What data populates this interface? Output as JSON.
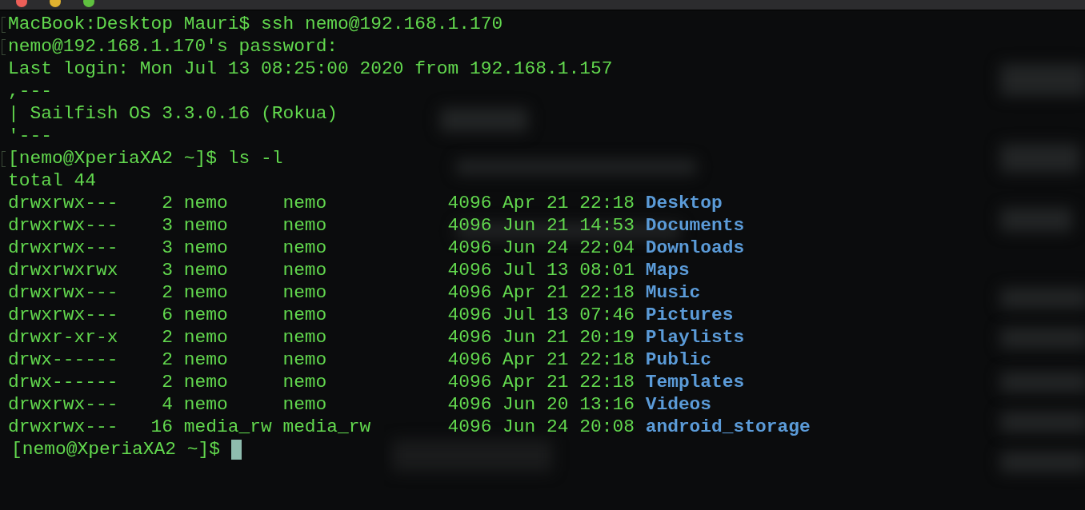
{
  "terminal": {
    "lines": [
      {
        "text": "MacBook:Desktop Mauri$ ssh nemo@192.168.1.170",
        "marked": true
      },
      {
        "text": "nemo@192.168.1.170's password:",
        "marked": true
      },
      {
        "text": "Last login: Mon Jul 13 08:25:00 2020 from 192.168.1.157",
        "marked": false
      },
      {
        "text": ",---",
        "marked": false
      },
      {
        "text": "| Sailfish OS 3.3.0.16 (Rokua)",
        "marked": false
      },
      {
        "text": "'---",
        "marked": false
      },
      {
        "text": "[nemo@XperiaXA2 ~]$ ls -l",
        "marked": true
      },
      {
        "text": "total 44",
        "marked": false
      }
    ],
    "listing": [
      {
        "mode": "drwxrwx---",
        "links": "2",
        "owner": "nemo",
        "group": "nemo",
        "size": "4096",
        "date": "Apr 21 22:18",
        "name": "Desktop"
      },
      {
        "mode": "drwxrwx---",
        "links": "3",
        "owner": "nemo",
        "group": "nemo",
        "size": "4096",
        "date": "Jun 21 14:53",
        "name": "Documents"
      },
      {
        "mode": "drwxrwx---",
        "links": "3",
        "owner": "nemo",
        "group": "nemo",
        "size": "4096",
        "date": "Jun 24 22:04",
        "name": "Downloads"
      },
      {
        "mode": "drwxrwxrwx",
        "links": "3",
        "owner": "nemo",
        "group": "nemo",
        "size": "4096",
        "date": "Jul 13 08:01",
        "name": "Maps"
      },
      {
        "mode": "drwxrwx---",
        "links": "2",
        "owner": "nemo",
        "group": "nemo",
        "size": "4096",
        "date": "Apr 21 22:18",
        "name": "Music"
      },
      {
        "mode": "drwxrwx---",
        "links": "6",
        "owner": "nemo",
        "group": "nemo",
        "size": "4096",
        "date": "Jul 13 07:46",
        "name": "Pictures"
      },
      {
        "mode": "drwxr-xr-x",
        "links": "2",
        "owner": "nemo",
        "group": "nemo",
        "size": "4096",
        "date": "Jun 21 20:19",
        "name": "Playlists"
      },
      {
        "mode": "drwx------",
        "links": "2",
        "owner": "nemo",
        "group": "nemo",
        "size": "4096",
        "date": "Apr 21 22:18",
        "name": "Public"
      },
      {
        "mode": "drwx------",
        "links": "2",
        "owner": "nemo",
        "group": "nemo",
        "size": "4096",
        "date": "Apr 21 22:18",
        "name": "Templates"
      },
      {
        "mode": "drwxrwx---",
        "links": "4",
        "owner": "nemo",
        "group": "nemo",
        "size": "4096",
        "date": "Jun 20 13:16",
        "name": "Videos"
      },
      {
        "mode": "drwxrwx---",
        "links": "16",
        "owner": "media_rw",
        "group": "media_rw",
        "size": "4096",
        "date": "Jun 24 20:08",
        "name": "android_storage"
      }
    ],
    "prompt": "[nemo@XperiaXA2 ~]$"
  }
}
